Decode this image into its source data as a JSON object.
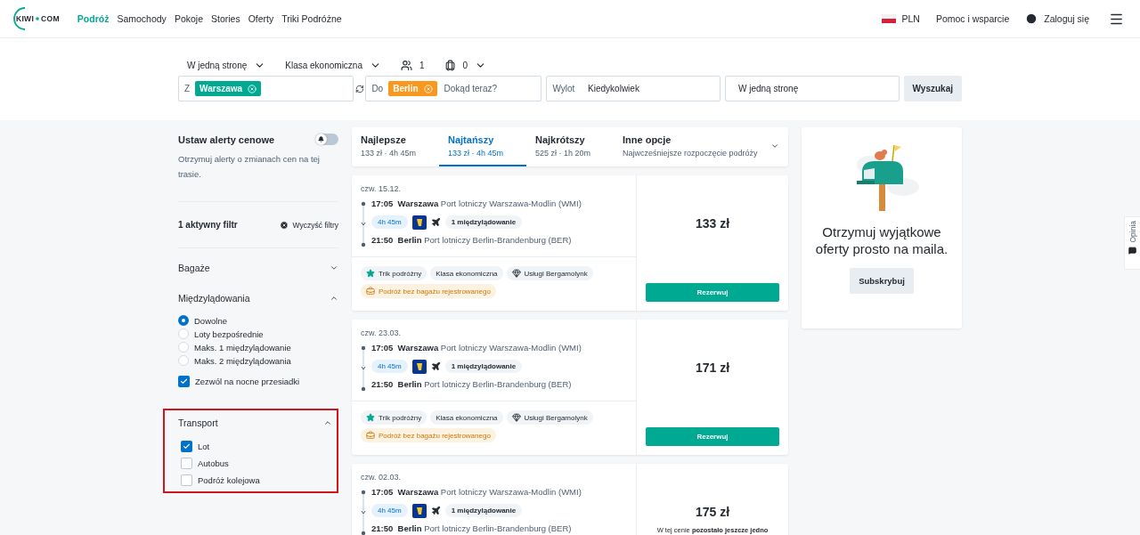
{
  "header": {
    "logo": {
      "left": "KIWI",
      "right": "COM"
    },
    "nav": [
      {
        "label": "Podróż",
        "selected": true
      },
      {
        "label": "Samochody",
        "selected": false
      },
      {
        "label": "Pokoje",
        "selected": false
      },
      {
        "label": "Stories",
        "selected": false
      },
      {
        "label": "Oferty",
        "selected": false
      },
      {
        "label": "Triki Podróżne",
        "selected": false
      }
    ],
    "currency": "PLN",
    "help": "Pomoc i wsparcie",
    "login": "Zaloguj się"
  },
  "search": {
    "options": [
      {
        "kind": "dropdown",
        "label": "W jedną stronę"
      },
      {
        "kind": "dropdown",
        "label": "Klasa ekonomiczna"
      },
      {
        "kind": "passengers",
        "label": "1"
      },
      {
        "kind": "bags",
        "label": "0"
      }
    ],
    "from": {
      "prefix": "Z",
      "chip": "Warszawa"
    },
    "to": {
      "prefix": "Do",
      "chip": "Berlin",
      "placeholder": "Dokąd teraz?"
    },
    "departure": {
      "label": "Wylot",
      "value": "Kiedykolwiek"
    },
    "return": {
      "value": "W jedną stronę"
    },
    "button": "Wyszukaj"
  },
  "sidebar": {
    "alert": {
      "title": "Ustaw alerty cenowe",
      "text": "Otrzymuj alerty o zmianach cen na tej trasie.",
      "on": false
    },
    "active_filters": {
      "label": "1 aktywny filtr",
      "clear": "Wyczyść filtry"
    },
    "sections": [
      {
        "title": "Bagaże",
        "expanded": false,
        "highlighted": false
      },
      {
        "title": "Międzylądowania",
        "expanded": true,
        "highlighted": false,
        "options": [
          {
            "kind": "radio",
            "label": "Dowolne",
            "selected": true
          },
          {
            "kind": "radio",
            "label": "Loty bezpośrednie",
            "selected": false
          },
          {
            "kind": "radio",
            "label": "Maks. 1 międzylądowanie",
            "selected": false
          },
          {
            "kind": "radio",
            "label": "Maks. 2 międzylądowania",
            "selected": false
          },
          {
            "kind": "checkbox",
            "label": "Zezwól na nocne przesiadki",
            "checked": true
          }
        ]
      },
      {
        "title": "Transport",
        "expanded": true,
        "highlighted": true,
        "options": [
          {
            "kind": "checkbox",
            "label": "Lot",
            "checked": true
          },
          {
            "kind": "checkbox",
            "label": "Autobus",
            "checked": false
          },
          {
            "kind": "checkbox",
            "label": "Podróż kolejowa",
            "checked": false
          }
        ]
      }
    ]
  },
  "sort_tabs": [
    {
      "kind": "tab",
      "title": "Najlepsze",
      "detail": "133 zł · 4h 45m",
      "selected": false
    },
    {
      "kind": "tab",
      "title": "Najtańszy",
      "detail": "133 zł · 4h 45m",
      "selected": true
    },
    {
      "kind": "tab",
      "title": "Najkrótszy",
      "detail": "525 zł · 1h 20m",
      "selected": false
    },
    {
      "kind": "menu",
      "title": "Inne opcje",
      "detail": "Najwcześniejsze rozpoczęcie podróży",
      "selected": false
    }
  ],
  "results": [
    {
      "date": "czw. 15.12.",
      "departure": {
        "time": "17:05",
        "city": "Warszawa",
        "airport": "Port lotniczy Warszawa-Modlin (WMI)"
      },
      "duration": "4h 45m",
      "stops": "1 międzylądowanie",
      "arrival": {
        "time": "21:50",
        "city": "Berlin",
        "airport": "Port lotniczy Berlin-Brandenburg (BER)"
      },
      "tags": [
        {
          "kind": "trick",
          "label": "Trik podróżny"
        },
        {
          "kind": "plain",
          "label": "Klasa ekonomiczna"
        },
        {
          "kind": "service",
          "label": "Usługi Bergamolynk"
        },
        {
          "kind": "warning",
          "label": "Podróż bez bagażu rejestrowanego"
        }
      ],
      "price": "133 zł",
      "button": "Rezerwuj"
    },
    {
      "date": "czw. 23.03.",
      "departure": {
        "time": "17:05",
        "city": "Warszawa",
        "airport": "Port lotniczy Warszawa-Modlin (WMI)"
      },
      "duration": "4h 45m",
      "stops": "1 międzylądowanie",
      "arrival": {
        "time": "21:50",
        "city": "Berlin",
        "airport": "Port lotniczy Berlin-Brandenburg (BER)"
      },
      "tags": [
        {
          "kind": "trick",
          "label": "Trik podróżny"
        },
        {
          "kind": "plain",
          "label": "Klasa ekonomiczna"
        },
        {
          "kind": "service",
          "label": "Usługi Bergamolynk"
        },
        {
          "kind": "warning",
          "label": "Podróż bez bagażu rejestrowanego"
        }
      ],
      "price": "171 zł",
      "button": "Rezerwuj"
    },
    {
      "date": "czw. 02.03.",
      "departure": {
        "time": "17:05",
        "city": "Warszawa",
        "airport": "Port lotniczy Warszawa-Modlin (WMI)"
      },
      "duration": "4h 45m",
      "stops": "1 międzylądowanie",
      "arrival": {
        "time": "21:50",
        "city": "Berlin",
        "airport": "Port lotniczy Berlin-Brandenburg (BER)"
      },
      "price": "175 zł",
      "note": "W tej cenie **pozostało jeszcze jedno**"
    }
  ],
  "promo": {
    "title": "Otrzymuj wyjątkowe oferty prosto na maila.",
    "button": "Subskrybuj"
  },
  "feedback": {
    "label": "Opinia"
  }
}
